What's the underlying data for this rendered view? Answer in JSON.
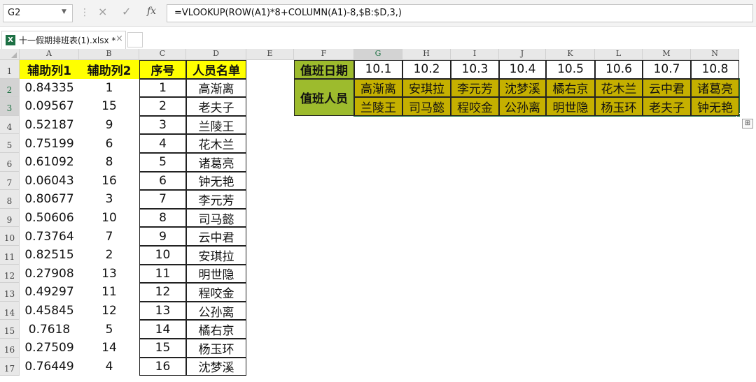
{
  "formula_bar": {
    "name_box": "G2",
    "formula": "=VLOOKUP(ROW(A1)*8+COLUMN(A1)-8,$B:$D,3,)"
  },
  "tab": {
    "label": "十一假期排班表(1).xlsx *",
    "close": "×"
  },
  "columns": [
    "A",
    "B",
    "C",
    "D",
    "E",
    "F",
    "G",
    "H",
    "I",
    "J",
    "K",
    "L",
    "M",
    "N"
  ],
  "rows": [
    "1",
    "2",
    "3",
    "4",
    "5",
    "6",
    "7",
    "8",
    "9",
    "10",
    "11",
    "12",
    "13",
    "14",
    "15",
    "16",
    "17"
  ],
  "left_headers": [
    "辅助列1",
    "辅助列2",
    "序号",
    "人员名单"
  ],
  "left_rows": [
    [
      "0.84335",
      "1",
      "1",
      "高渐离"
    ],
    [
      "0.09567",
      "15",
      "2",
      "老夫子"
    ],
    [
      "0.52187",
      "9",
      "3",
      "兰陵王"
    ],
    [
      "0.75199",
      "6",
      "4",
      "花木兰"
    ],
    [
      "0.61092",
      "8",
      "5",
      "诸葛亮"
    ],
    [
      "0.06043",
      "16",
      "6",
      "钟无艳"
    ],
    [
      "0.80677",
      "3",
      "7",
      "李元芳"
    ],
    [
      "0.50606",
      "10",
      "8",
      "司马懿"
    ],
    [
      "0.73764",
      "7",
      "9",
      "云中君"
    ],
    [
      "0.82515",
      "2",
      "10",
      "安琪拉"
    ],
    [
      "0.27908",
      "13",
      "11",
      "明世隐"
    ],
    [
      "0.49297",
      "11",
      "12",
      "程咬金"
    ],
    [
      "0.45845",
      "12",
      "13",
      "公孙离"
    ],
    [
      "0.7618",
      "5",
      "14",
      "橘右京"
    ],
    [
      "0.27509",
      "14",
      "15",
      "杨玉环"
    ],
    [
      "0.76449",
      "4",
      "16",
      "沈梦溪"
    ]
  ],
  "schedule": {
    "date_label": "值班日期",
    "staff_label": "值班人员",
    "dates": [
      "10.1",
      "10.2",
      "10.3",
      "10.4",
      "10.5",
      "10.6",
      "10.7",
      "10.8"
    ],
    "row1": [
      "高渐离",
      "安琪拉",
      "李元芳",
      "沈梦溪",
      "橘右京",
      "花木兰",
      "云中君",
      "诸葛亮"
    ],
    "row2": [
      "兰陵王",
      "司马懿",
      "程咬金",
      "公孙离",
      "明世隐",
      "杨玉环",
      "老夫子",
      "钟无艳"
    ]
  },
  "icons": {
    "cancel": "×",
    "enter": "✓",
    "fx": "fx",
    "excel": "X",
    "paste_options": "⊞"
  }
}
